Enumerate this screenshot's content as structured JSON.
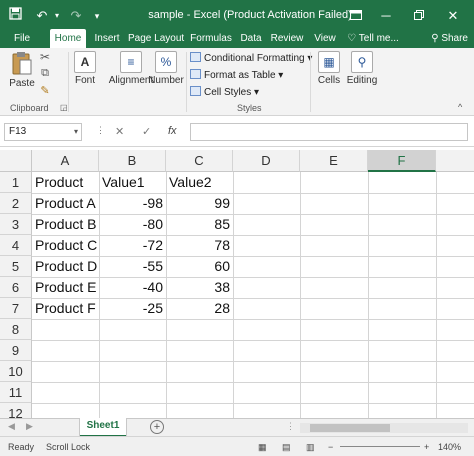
{
  "titlebar": {
    "save_icon": "save-icon",
    "undo_icon": "undo-icon",
    "redo_icon": "redo-icon",
    "title": "sample - Excel (Product Activation Failed)",
    "minimize_icon": "minimize-icon",
    "restore_icon": "restore-icon",
    "close_icon": "close-icon"
  },
  "ribbon_tabs": [
    "File",
    "Home",
    "Insert",
    "Page Layout",
    "Formulas",
    "Data",
    "Review",
    "View"
  ],
  "tell_me": "Tell me...",
  "share": "Share",
  "ribbon": {
    "paste": "Paste",
    "clipboard": "Clipboard",
    "font": "Font",
    "alignment": "Alignment",
    "number": "Number",
    "conditional_formatting": "Conditional Formatting",
    "format_as_table": "Format as Table",
    "cell_styles": "Cell Styles",
    "styles": "Styles",
    "cells": "Cells",
    "editing": "Editing"
  },
  "formula_bar": {
    "name_box": "F13",
    "cancel": "✕",
    "enter": "✓",
    "fx": "fx",
    "value": ""
  },
  "columns": [
    "A",
    "B",
    "C",
    "D",
    "E",
    "F"
  ],
  "row_numbers": [
    "1",
    "2",
    "3",
    "4",
    "5",
    "6",
    "7",
    "8",
    "9",
    "10",
    "11",
    "12"
  ],
  "cells": {
    "header": [
      "Product",
      "Value1",
      "Value2"
    ],
    "rows": [
      [
        "Product A",
        "-98",
        "99"
      ],
      [
        "Product B",
        "-80",
        "85"
      ],
      [
        "Product C",
        "-72",
        "78"
      ],
      [
        "Product D",
        "-55",
        "60"
      ],
      [
        "Product E",
        "-40",
        "38"
      ],
      [
        "Product F",
        "-25",
        "28"
      ]
    ]
  },
  "sheets": [
    "Sheet1"
  ],
  "status": {
    "ready": "Ready",
    "scroll_lock": "Scroll Lock",
    "zoom": "140%"
  },
  "colors": {
    "excel_green": "#217346",
    "ribbon_bg": "#f3f3f3",
    "header_bg": "#f2f2f2"
  }
}
